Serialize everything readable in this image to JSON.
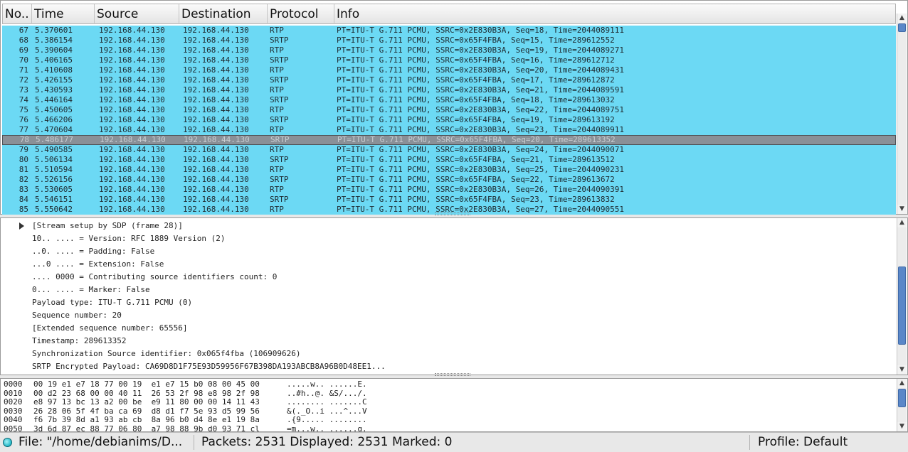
{
  "packet_list": {
    "columns": [
      "No..",
      "Time",
      "Source",
      "Destination",
      "Protocol",
      "Info"
    ],
    "rows": [
      {
        "no": "67",
        "time": "5.370601",
        "src": "192.168.44.130",
        "dst": "192.168.44.130",
        "proto": "RTP",
        "info": "PT=ITU-T G.711 PCMU, SSRC=0x2E830B3A, Seq=18, Time=2044089111"
      },
      {
        "no": "68",
        "time": "5.386154",
        "src": "192.168.44.130",
        "dst": "192.168.44.130",
        "proto": "SRTP",
        "info": "PT=ITU-T G.711 PCMU, SSRC=0x65F4FBA, Seq=15, Time=289612552"
      },
      {
        "no": "69",
        "time": "5.390604",
        "src": "192.168.44.130",
        "dst": "192.168.44.130",
        "proto": "RTP",
        "info": "PT=ITU-T G.711 PCMU, SSRC=0x2E830B3A, Seq=19, Time=2044089271"
      },
      {
        "no": "70",
        "time": "5.406165",
        "src": "192.168.44.130",
        "dst": "192.168.44.130",
        "proto": "SRTP",
        "info": "PT=ITU-T G.711 PCMU, SSRC=0x65F4FBA, Seq=16, Time=289612712"
      },
      {
        "no": "71",
        "time": "5.410608",
        "src": "192.168.44.130",
        "dst": "192.168.44.130",
        "proto": "RTP",
        "info": "PT=ITU-T G.711 PCMU, SSRC=0x2E830B3A, Seq=20, Time=2044089431"
      },
      {
        "no": "72",
        "time": "5.426155",
        "src": "192.168.44.130",
        "dst": "192.168.44.130",
        "proto": "SRTP",
        "info": "PT=ITU-T G.711 PCMU, SSRC=0x65F4FBA, Seq=17, Time=289612872"
      },
      {
        "no": "73",
        "time": "5.430593",
        "src": "192.168.44.130",
        "dst": "192.168.44.130",
        "proto": "RTP",
        "info": "PT=ITU-T G.711 PCMU, SSRC=0x2E830B3A, Seq=21, Time=2044089591"
      },
      {
        "no": "74",
        "time": "5.446164",
        "src": "192.168.44.130",
        "dst": "192.168.44.130",
        "proto": "SRTP",
        "info": "PT=ITU-T G.711 PCMU, SSRC=0x65F4FBA, Seq=18, Time=289613032"
      },
      {
        "no": "75",
        "time": "5.450605",
        "src": "192.168.44.130",
        "dst": "192.168.44.130",
        "proto": "RTP",
        "info": "PT=ITU-T G.711 PCMU, SSRC=0x2E830B3A, Seq=22, Time=2044089751"
      },
      {
        "no": "76",
        "time": "5.466206",
        "src": "192.168.44.130",
        "dst": "192.168.44.130",
        "proto": "SRTP",
        "info": "PT=ITU-T G.711 PCMU, SSRC=0x65F4FBA, Seq=19, Time=289613192"
      },
      {
        "no": "77",
        "time": "5.470604",
        "src": "192.168.44.130",
        "dst": "192.168.44.130",
        "proto": "RTP",
        "info": "PT=ITU-T G.711 PCMU, SSRC=0x2E830B3A, Seq=23, Time=2044089911"
      },
      {
        "no": "78",
        "time": "5.486177",
        "src": "192.168.44.130",
        "dst": "192.168.44.130",
        "proto": "SRTP",
        "info": "PT=ITU-T G.711 PCMU, SSRC=0x65F4FBA, Seq=20, Time=289613352",
        "selected": true
      },
      {
        "no": "79",
        "time": "5.490585",
        "src": "192.168.44.130",
        "dst": "192.168.44.130",
        "proto": "RTP",
        "info": "PT=ITU-T G.711 PCMU, SSRC=0x2E830B3A, Seq=24, Time=2044090071"
      },
      {
        "no": "80",
        "time": "5.506134",
        "src": "192.168.44.130",
        "dst": "192.168.44.130",
        "proto": "SRTP",
        "info": "PT=ITU-T G.711 PCMU, SSRC=0x65F4FBA, Seq=21, Time=289613512"
      },
      {
        "no": "81",
        "time": "5.510594",
        "src": "192.168.44.130",
        "dst": "192.168.44.130",
        "proto": "RTP",
        "info": "PT=ITU-T G.711 PCMU, SSRC=0x2E830B3A, Seq=25, Time=2044090231"
      },
      {
        "no": "82",
        "time": "5.526156",
        "src": "192.168.44.130",
        "dst": "192.168.44.130",
        "proto": "SRTP",
        "info": "PT=ITU-T G.711 PCMU, SSRC=0x65F4FBA, Seq=22, Time=289613672"
      },
      {
        "no": "83",
        "time": "5.530605",
        "src": "192.168.44.130",
        "dst": "192.168.44.130",
        "proto": "RTP",
        "info": "PT=ITU-T G.711 PCMU, SSRC=0x2E830B3A, Seq=26, Time=2044090391"
      },
      {
        "no": "84",
        "time": "5.546151",
        "src": "192.168.44.130",
        "dst": "192.168.44.130",
        "proto": "SRTP",
        "info": "PT=ITU-T G.711 PCMU, SSRC=0x65F4FBA, Seq=23, Time=289613832"
      },
      {
        "no": "85",
        "time": "5.550642",
        "src": "192.168.44.130",
        "dst": "192.168.44.130",
        "proto": "RTP",
        "info": "PT=ITU-T G.711 PCMU, SSRC=0x2E830B3A, Seq=27, Time=2044090551"
      }
    ],
    "row_color": "#6cd9f4",
    "selected_color": "#8a9097"
  },
  "details": {
    "lines": [
      "[Stream setup by SDP (frame 28)]",
      "10.. .... = Version: RFC 1889 Version (2)",
      "..0. .... = Padding: False",
      "...0 .... = Extension: False",
      ".... 0000 = Contributing source identifiers count: 0",
      "0... .... = Marker: False",
      "Payload type: ITU-T G.711 PCMU (0)",
      "Sequence number: 20",
      "[Extended sequence number: 65556]",
      "Timestamp: 289613352",
      "Synchronization Source identifier: 0x065f4fba (106909626)",
      "SRTP Encrypted Payload: CA69D8D1F75E93D59956F67B398DA193ABCB8A96B0D48EE1..."
    ],
    "expander_icon": "triangle-right-icon"
  },
  "bytes": {
    "rows": [
      {
        "offset": "0000",
        "hex": "00 19 e1 e7 18 77 00 19  e1 e7 15 b0 08 00 45 00",
        "ascii": ".....w.. ......E."
      },
      {
        "offset": "0010",
        "hex": "00 d2 23 68 00 00 40 11  26 53 2f 98 e8 98 2f 98",
        "ascii": "..#h..@. &S/.../."
      },
      {
        "offset": "0020",
        "hex": "e8 97 13 bc 13 a2 00 be  e9 11 80 00 00 14 11 43",
        "ascii": "........ .......C"
      },
      {
        "offset": "0030",
        "hex": "26 28 06 5f 4f ba ca 69  d8 d1 f7 5e 93 d5 99 56",
        "ascii": "&(._O..i ...^...V"
      },
      {
        "offset": "0040",
        "hex": "f6 7b 39 8d a1 93 ab cb  8a 96 b0 d4 8e e1 19 8a",
        "ascii": ".{9..... ........"
      },
      {
        "offset": "0050",
        "hex": "3d 6d 87 ec 88 77 06 80  a7 98 88 9b d0 93 71 cl",
        "ascii": "=m...w.. ......q."
      }
    ]
  },
  "statusbar": {
    "file": "File: \"/home/debianims/D...",
    "packets": "Packets: 2531 Displayed: 2531 Marked: 0",
    "profile": "Profile: Default",
    "led_icon": "status-led-icon"
  }
}
